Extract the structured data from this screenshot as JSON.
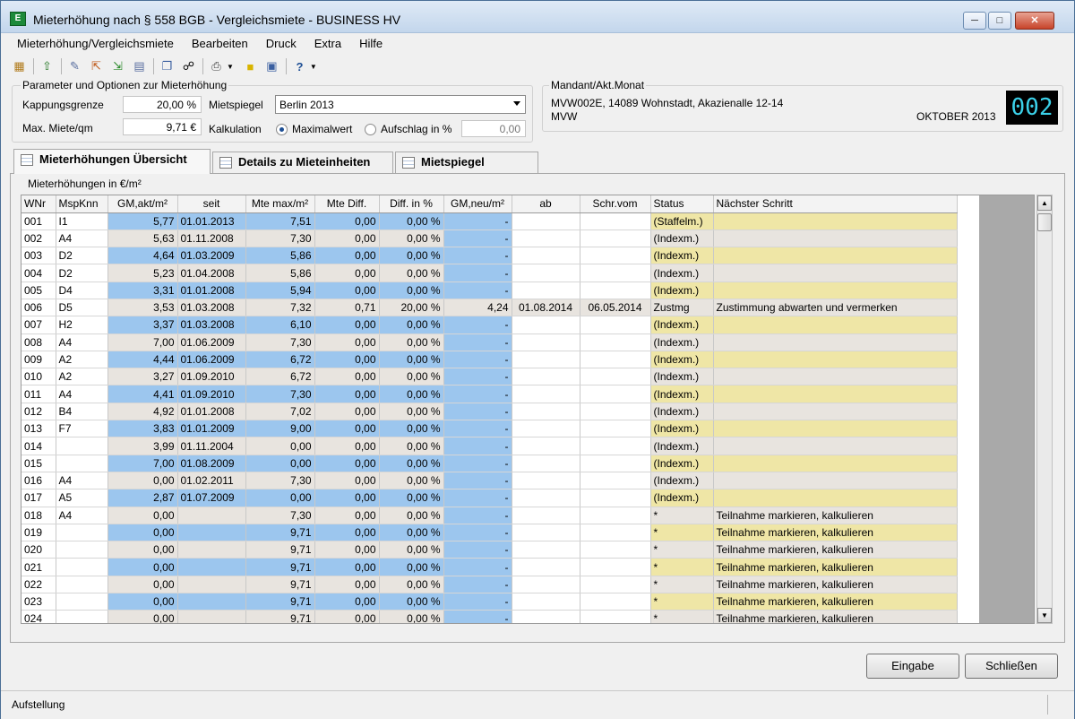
{
  "window": {
    "title": "Mieterhöhung nach § 558 BGB - Vergleichsmiete - BUSINESS HV",
    "icon_label": "E"
  },
  "menu": [
    "Mieterhöhung/Vergleichsmiete",
    "Bearbeiten",
    "Druck",
    "Extra",
    "Hilfe"
  ],
  "toolbar_icons": [
    "properties-icon",
    "upload-icon",
    "edit-icon",
    "export-icon",
    "import-icon",
    "document-icon",
    "copy-icon",
    "binoculars-icon",
    "print-icon",
    "note-icon",
    "preview-icon",
    "help-icon"
  ],
  "params": {
    "group_title": "Parameter und Optionen zur Mieterhöhung",
    "kappung_label": "Kappungsgrenze",
    "kappung_value": "20,00 %",
    "maxmiete_label": "Max. Miete/qm",
    "maxmiete_value": "9,71 €",
    "mietspiegel_label": "Mietspiegel",
    "mietspiegel_value": "Berlin 2013",
    "kalkulation_label": "Kalkulation",
    "radio_max": "Maximalwert",
    "radio_aufschlag": "Aufschlag in %",
    "aufschlag_value": "0,00"
  },
  "mandant": {
    "group_title": "Mandant/Akt.Monat",
    "line1": "MVW002E, 14089 Wohnstadt, Akazienalle 12-14",
    "line2": "MVW",
    "month": "OKTOBER 2013",
    "code": "002"
  },
  "tabs": [
    "Mieterhöhungen Übersicht",
    "Details zu Mieteinheiten",
    "Mietspiegel"
  ],
  "grid": {
    "section_title": "Mieterhöhungen in €/m²",
    "columns": [
      "WNr",
      "MspKnn",
      "GM,akt/m²",
      "seit",
      "Mte max/m²",
      "Mte Diff.",
      "Diff. in %",
      "GM,neu/m²",
      "ab",
      "Schr.vom",
      "Status",
      "Nächster Schritt"
    ],
    "rows": [
      [
        "001",
        "I1",
        "5,77",
        "01.01.2013",
        "7,51",
        "0,00",
        "0,00 %",
        "-",
        "",
        "",
        "(Staffelm.)",
        ""
      ],
      [
        "002",
        "A4",
        "5,63",
        "01.11.2008",
        "7,30",
        "0,00",
        "0,00 %",
        "-",
        "",
        "",
        "(Indexm.)",
        ""
      ],
      [
        "003",
        "D2",
        "4,64",
        "01.03.2009",
        "5,86",
        "0,00",
        "0,00 %",
        "-",
        "",
        "",
        "(Indexm.)",
        ""
      ],
      [
        "004",
        "D2",
        "5,23",
        "01.04.2008",
        "5,86",
        "0,00",
        "0,00 %",
        "-",
        "",
        "",
        "(Indexm.)",
        ""
      ],
      [
        "005",
        "D4",
        "3,31",
        "01.01.2008",
        "5,94",
        "0,00",
        "0,00 %",
        "-",
        "",
        "",
        "(Indexm.)",
        ""
      ],
      [
        "006",
        "D5",
        "3,53",
        "01.03.2008",
        "7,32",
        "0,71",
        "20,00 %",
        "4,24",
        "01.08.2014",
        "06.05.2014",
        "Zustmg",
        "Zustimmung abwarten und vermerken"
      ],
      [
        "007",
        "H2",
        "3,37",
        "01.03.2008",
        "6,10",
        "0,00",
        "0,00 %",
        "-",
        "",
        "",
        "(Indexm.)",
        ""
      ],
      [
        "008",
        "A4",
        "7,00",
        "01.06.2009",
        "7,30",
        "0,00",
        "0,00 %",
        "-",
        "",
        "",
        "(Indexm.)",
        ""
      ],
      [
        "009",
        "A2",
        "4,44",
        "01.06.2009",
        "6,72",
        "0,00",
        "0,00 %",
        "-",
        "",
        "",
        "(Indexm.)",
        ""
      ],
      [
        "010",
        "A2",
        "3,27",
        "01.09.2010",
        "6,72",
        "0,00",
        "0,00 %",
        "-",
        "",
        "",
        "(Indexm.)",
        ""
      ],
      [
        "011",
        "A4",
        "4,41",
        "01.09.2010",
        "7,30",
        "0,00",
        "0,00 %",
        "-",
        "",
        "",
        "(Indexm.)",
        ""
      ],
      [
        "012",
        "B4",
        "4,92",
        "01.01.2008",
        "7,02",
        "0,00",
        "0,00 %",
        "-",
        "",
        "",
        "(Indexm.)",
        ""
      ],
      [
        "013",
        "F7",
        "3,83",
        "01.01.2009",
        "9,00",
        "0,00",
        "0,00 %",
        "-",
        "",
        "",
        "(Indexm.)",
        ""
      ],
      [
        "014",
        "",
        "3,99",
        "01.11.2004",
        "0,00",
        "0,00",
        "0,00 %",
        "-",
        "",
        "",
        "(Indexm.)",
        ""
      ],
      [
        "015",
        "",
        "7,00",
        "01.08.2009",
        "0,00",
        "0,00",
        "0,00 %",
        "-",
        "",
        "",
        "(Indexm.)",
        ""
      ],
      [
        "016",
        "A4",
        "0,00",
        "01.02.2011",
        "7,30",
        "0,00",
        "0,00 %",
        "-",
        "",
        "",
        "(Indexm.)",
        ""
      ],
      [
        "017",
        "A5",
        "2,87",
        "01.07.2009",
        "0,00",
        "0,00",
        "0,00 %",
        "-",
        "",
        "",
        "(Indexm.)",
        ""
      ],
      [
        "018",
        "A4",
        "0,00",
        "",
        "7,30",
        "0,00",
        "0,00 %",
        "-",
        "",
        "",
        "*",
        "Teilnahme markieren, kalkulieren"
      ],
      [
        "019",
        "",
        "0,00",
        "",
        "9,71",
        "0,00",
        "0,00 %",
        "-",
        "",
        "",
        "*",
        "Teilnahme markieren, kalkulieren"
      ],
      [
        "020",
        "",
        "0,00",
        "",
        "9,71",
        "0,00",
        "0,00 %",
        "-",
        "",
        "",
        "*",
        "Teilnahme markieren, kalkulieren"
      ],
      [
        "021",
        "",
        "0,00",
        "",
        "9,71",
        "0,00",
        "0,00 %",
        "-",
        "",
        "",
        "*",
        "Teilnahme markieren, kalkulieren"
      ],
      [
        "022",
        "",
        "0,00",
        "",
        "9,71",
        "0,00",
        "0,00 %",
        "-",
        "",
        "",
        "*",
        "Teilnahme markieren, kalkulieren"
      ],
      [
        "023",
        "",
        "0,00",
        "",
        "9,71",
        "0,00",
        "0,00 %",
        "-",
        "",
        "",
        "*",
        "Teilnahme markieren, kalkulieren"
      ],
      [
        "024",
        "",
        "0,00",
        "",
        "9,71",
        "0,00",
        "0,00 %",
        "-",
        "",
        "",
        "*",
        "Teilnahme markieren, kalkulieren"
      ]
    ]
  },
  "colors": {
    "blue": "#9cc6ee",
    "grey": "#e8e4df",
    "yellow": "#efe6a6",
    "white": "#ffffff"
  },
  "buttons": {
    "eingabe": "Eingabe",
    "schliessen": "Schließen"
  },
  "status": {
    "text": "Aufstellung"
  }
}
